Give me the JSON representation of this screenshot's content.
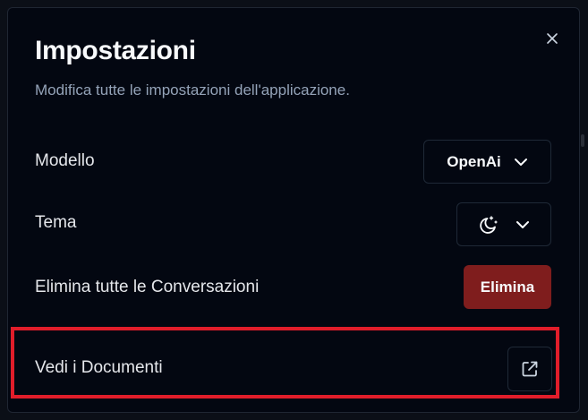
{
  "dialog": {
    "title": "Impostazioni",
    "subtitle": "Modifica tutte le impostazioni dell'applicazione."
  },
  "settings": {
    "model": {
      "label": "Modello",
      "value": "OpenAi"
    },
    "theme": {
      "label": "Tema",
      "icon": "moon-stars-icon"
    },
    "delete": {
      "label": "Elimina tutte le Conversazioni",
      "button": "Elimina"
    },
    "docs": {
      "label": "Vedi i Documenti",
      "icon": "external-link-icon"
    }
  },
  "colors": {
    "background": "#030711",
    "danger": "#7f1d1d",
    "highlight": "#e11d2a",
    "muted_text": "#94a3b8"
  }
}
